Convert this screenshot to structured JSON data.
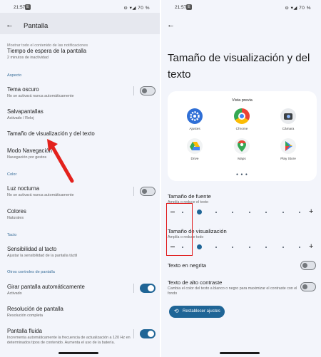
{
  "left": {
    "status": {
      "time": "21:57",
      "badge": "E",
      "battery": "70 %"
    },
    "header": {
      "title": "Pantalla"
    },
    "cut_text": "Mostrar todo el contenido de las notificaciones",
    "items": [
      {
        "title": "Tiempo de espera de la pantalla",
        "subtitle": "2 minutos de inactividad"
      },
      {
        "title": "Tema oscuro",
        "subtitle": "No se activará nunca automáticamente",
        "toggle": "off"
      },
      {
        "title": "Salvapantallas",
        "subtitle": "Activado / Reloj"
      },
      {
        "title": "Tamaño de visualización y del texto",
        "subtitle": ""
      },
      {
        "title": "Modo Navegación",
        "subtitle": "Navegación por gestos"
      },
      {
        "title": "Luz nocturna",
        "subtitle": "No se activará nunca automáticamente",
        "toggle": "off"
      },
      {
        "title": "Colores",
        "subtitle": "Naturales"
      },
      {
        "title": "Sensibilidad al tacto",
        "subtitle": "Ajustar la sensibilidad de la pantalla táctil"
      },
      {
        "title": "Girar pantalla automáticamente",
        "subtitle": "Activado",
        "toggle": "on"
      },
      {
        "title": "Resolución de pantalla",
        "subtitle": "Resolución completa"
      },
      {
        "title": "Pantalla fluida",
        "subtitle": "Incrementa automáticamente la frecuencia de actualización a 120 Hz en determinados tipos de contenido. Aumenta el uso de la batería.",
        "toggle": "on"
      }
    ],
    "sections": [
      "Aspecto",
      "Color",
      "Tacto",
      "Otros controles de pantalla"
    ],
    "annotation_color": "#e3211c"
  },
  "right": {
    "status": {
      "time": "21:57",
      "badge": "E",
      "battery": "70 %"
    },
    "page_title": "Tamaño de visualización y del texto",
    "preview": {
      "title": "Vista previa",
      "apps": [
        {
          "label": "Ajustes",
          "icon": "settings-gear-icon"
        },
        {
          "label": "Chrome",
          "icon": "chrome-icon"
        },
        {
          "label": "Cámara",
          "icon": "camera-icon"
        },
        {
          "label": "Drive",
          "icon": "drive-icon"
        },
        {
          "label": "Maps",
          "icon": "maps-pin-icon"
        },
        {
          "label": "Play Store",
          "icon": "play-store-icon"
        }
      ],
      "dots": "● ● ●"
    },
    "font_size": {
      "title": "Tamaño de fuente",
      "subtitle": "Amplía o reduce el texto",
      "level": 1,
      "steps": 8
    },
    "display_size": {
      "title": "Tamaño de visualización",
      "subtitle": "Amplía o reduce todo",
      "level": 1,
      "steps": 8
    },
    "bold": {
      "title": "Texto en negrita",
      "toggle": "off"
    },
    "contrast": {
      "title": "Texto de alto contraste",
      "subtitle": "Cambia el color del texto a blanco o negro para maximizar el contraste con el fondo",
      "toggle": "off"
    },
    "reset_button": "Restablecer ajustes",
    "accent": "#1f6596"
  }
}
